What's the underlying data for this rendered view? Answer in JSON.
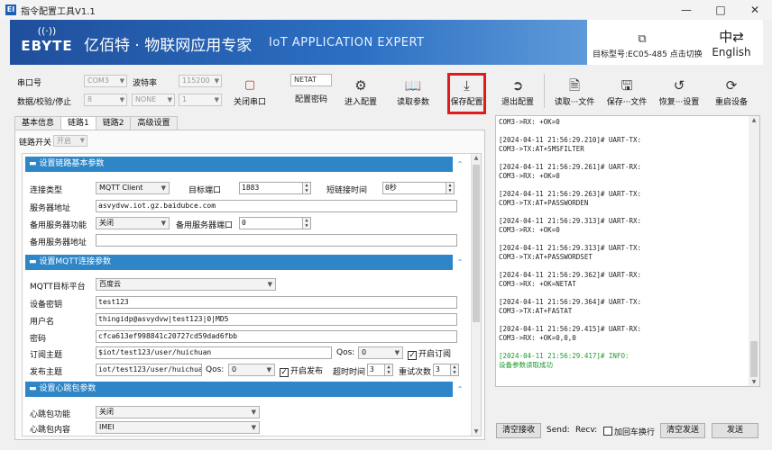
{
  "window": {
    "title": "指令配置工具V1.1",
    "app_icon": "EI",
    "controls": [
      "minimize-icon",
      "maximize-icon",
      "close-icon"
    ]
  },
  "banner": {
    "logo_text": "EBYTE",
    "slogan_cn": "亿佰特 · 物联网应用专家",
    "slogan_en": "IoT APPLICATION EXPERT",
    "model_label": "目标型号:EC05-485 点击切换",
    "language_label": "English"
  },
  "serial": {
    "port_label": "串口号",
    "port_value": "COM3",
    "baud_label": "波特率",
    "baud_value": "115200",
    "data_label": "数据/校验/停止",
    "data_value": "8",
    "parity_value": "NONE",
    "stop_value": "1",
    "close_port_label": "关闭串口"
  },
  "toolbar": {
    "password_value": "NETAT",
    "password_label": "配置密码",
    "enter_label": "进入配置",
    "read_label": "读取参数",
    "save_label": "保存配置",
    "exit_label": "退出配置",
    "read_file_label": "读取···文件",
    "save_file_label": "保存···文件",
    "restore_label": "恢复···设置",
    "restart_label": "重启设备"
  },
  "tabs": [
    "基本信息",
    "链路1",
    "链路2",
    "高级设置"
  ],
  "link": {
    "switch_label": "链路开关",
    "switch_value": "开启",
    "sec1_title": "设置链路基本参数",
    "conn_type_label": "连接类型",
    "conn_type_value": "MQTT Client",
    "target_port_label": "目标端口",
    "target_port_value": "1883",
    "short_conn_label": "短链接时间",
    "short_conn_value": "0秒",
    "server_addr_label": "服务器地址",
    "server_addr_value": "asvydvw.iot.gz.baidubce.com",
    "backup_func_label": "备用服务器功能",
    "backup_func_value": "关闭",
    "backup_port_label": "备用服务器端口",
    "backup_port_value": "0",
    "backup_addr_label": "备用服务器地址",
    "backup_addr_value": "",
    "sec2_title": "设置MQTT连接参数",
    "platform_label": "MQTT目标平台",
    "platform_value": "百度云",
    "device_key_label": "设备密钥",
    "device_key_value": "test123",
    "username_label": "用户名",
    "username_value": "thingidp@asvydvw|test123|0|MD5",
    "password_label": "密码",
    "password_value": "cfca613ef998841c20727cd59dad6fbb",
    "sub_topic_label": "订阅主题",
    "sub_topic_value": "$iot/test123/user/huichuan",
    "sub_qos_label": "Qos:",
    "sub_qos_value": "0",
    "sub_enable_label": "开启订阅",
    "pub_topic_label": "发布主题",
    "pub_topic_value": "iot/test123/user/huichuan",
    "pub_qos_label": "Qos:",
    "pub_qos_value": "0",
    "pub_enable_label": "开启发布",
    "timeout_label": "超时时间",
    "timeout_value": "3",
    "retry_label": "重试次数",
    "retry_value": "3",
    "sec3_title": "设置心跳包参数",
    "hb_func_label": "心跳包功能",
    "hb_func_value": "关闭",
    "hb_content_label": "心跳包内容",
    "hb_content_value": "IMEI"
  },
  "log": {
    "lines": [
      "COM3->RX: +OK=0",
      "",
      "[2024-04-11 21:56:29.210]# UART-TX:",
      "COM3->TX:AT+SMSFILTER",
      "",
      "[2024-04-11 21:56:29.261]# UART-RX:",
      "COM3->RX: +OK=0",
      "",
      "[2024-04-11 21:56:29.263]# UART-TX:",
      "COM3->TX:AT+PASSWORDEN",
      "",
      "[2024-04-11 21:56:29.313]# UART-RX:",
      "COM3->RX: +OK=0",
      "",
      "[2024-04-11 21:56:29.313]# UART-TX:",
      "COM3->TX:AT+PASSWORDSET",
      "",
      "[2024-04-11 21:56:29.362]# UART-RX:",
      "COM3->RX: +OK=NETAT",
      "",
      "[2024-04-11 21:56:29.364]# UART-TX:",
      "COM3->TX:AT+FASTAT",
      "",
      "[2024-04-11 21:56:29.415]# UART-RX:",
      "COM3->RX: +OK=0,0,0",
      "",
      "[2024-04-11 21:56:29.417]# INFO:",
      "设备参数读取成功"
    ],
    "info_color": "#1a9a2a"
  },
  "bottom": {
    "clear_recv_label": "清空接收",
    "send_label": "Send:",
    "recv_label": "Recv:",
    "crlf_label": "加回车换行",
    "clear_send_label": "清空发送",
    "send_button_label": "发送"
  },
  "colors": {
    "banner_blue": "#2c6fc2",
    "section_header": "#2e86c7",
    "highlight": "#e01b1b"
  }
}
